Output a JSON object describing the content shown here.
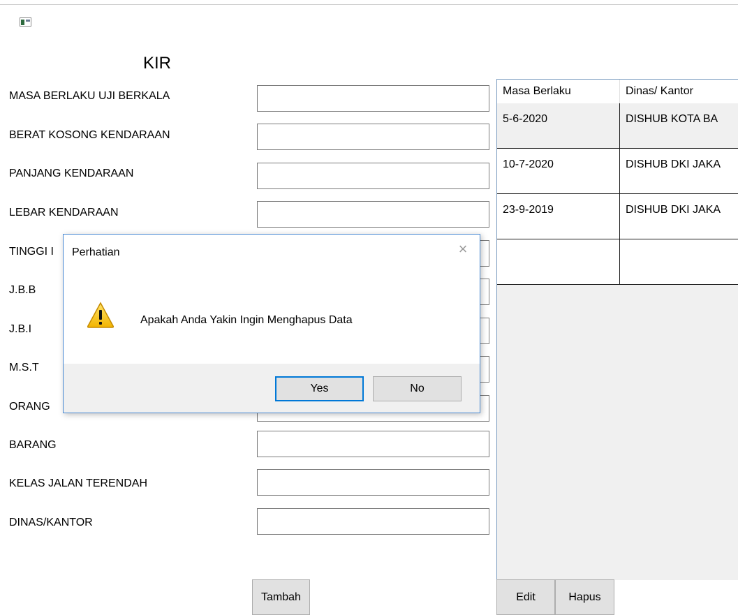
{
  "form": {
    "title": "KIR",
    "labels": [
      "MASA BERLAKU UJI BERKALA",
      "BERAT KOSONG KENDARAAN",
      "PANJANG KENDARAAN",
      "LEBAR KENDARAAN",
      "TINGGI I",
      "J.B.B",
      "J.B.I",
      "M.S.T",
      "ORANG",
      "BARANG",
      "KELAS JALAN TERENDAH",
      "DINAS/KANTOR"
    ],
    "field_values": [
      "",
      "",
      "",
      "",
      "",
      "",
      "",
      "",
      "",
      "",
      "",
      ""
    ],
    "add_button": "Tambah"
  },
  "grid": {
    "columns": [
      "Masa Berlaku",
      "Dinas/ Kantor"
    ],
    "rows": [
      [
        "5-6-2020",
        "DISHUB KOTA BA"
      ],
      [
        "10-7-2020",
        "DISHUB DKI JAKA"
      ],
      [
        "23-9-2019",
        "DISHUB DKI JAKA"
      ],
      [
        "",
        ""
      ]
    ],
    "edit_button": "Edit",
    "delete_button": "Hapus"
  },
  "dialog": {
    "title": "Perhatian",
    "message": "Apakah Anda Yakin Ingin Menghapus Data",
    "yes_label": "Yes",
    "no_label": "No",
    "close_glyph": "×",
    "icon": "warning-icon"
  },
  "colors": {
    "accent": "#0078d7",
    "dialog_border": "#4a8ad3",
    "grid_background": "#f0f0f0",
    "button_face": "#e1e1e1"
  }
}
